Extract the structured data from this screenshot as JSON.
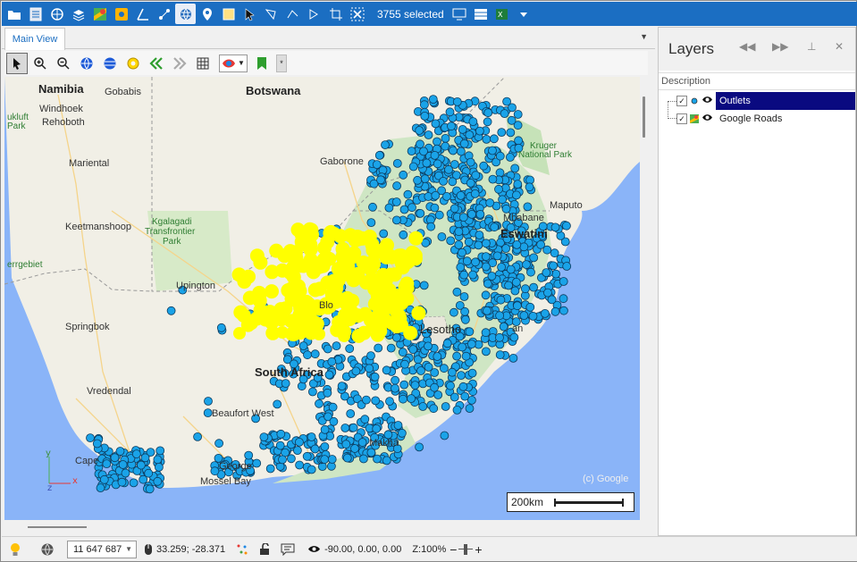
{
  "toolbar": {
    "selection_count": "3755 selected",
    "accent_color": "#1b6ec2"
  },
  "tabs": [
    {
      "label": "Main View"
    }
  ],
  "map": {
    "labels": {
      "namibia": "Namibia",
      "botswana": "Botswana",
      "gobabis": "Gobabis",
      "windhoek": "Windhoek",
      "rehoboth": "Rehoboth",
      "mariental": "Mariental",
      "keetmanshoop": "Keetmanshoop",
      "kgalagadi": "Kgalagadi",
      "transfrontier": "Transfrontier",
      "park": "Park",
      "gaborone": "Gaborone",
      "kruger": "Kruger",
      "national_park": "National Park",
      "maputo": "Maputo",
      "mbabane": "Mbabane",
      "eswatini": "Eswatini",
      "upington": "Upington",
      "springbok": "Springbok",
      "lesotho": "Lesotho",
      "south_africa": "South Africa",
      "vredendal": "Vredendal",
      "beaufort_west": "Beaufort West",
      "cape": "Cape",
      "george": "George",
      "mossel_bay": "Mossel Bay",
      "makhanda": "Makha",
      "bloem": "Blo",
      "durban": "an",
      "sperrgebiet": "errgebiet",
      "kgalagadi_left": "ukluft",
      "kgalagadi_left2": "Park",
      "zimbabwe": "Kruger"
    },
    "copyright": "(c) Google",
    "scale_label": "200km",
    "outlet_color": "#1aa3e8",
    "selected_color": "#ffff00"
  },
  "layers": {
    "title": "Layers",
    "column": "Description",
    "items": [
      {
        "name": "Outlets",
        "checked": true,
        "selected": true
      },
      {
        "name": "Google Roads",
        "checked": true,
        "selected": false
      }
    ]
  },
  "status": {
    "scale_value": "11 647 687",
    "coords": "33.259; -28.371",
    "rotation": "-90.00, 0.00, 0.00",
    "zoom": "Z:100%",
    "zoom_minus": "−",
    "zoom_plus": "+"
  }
}
